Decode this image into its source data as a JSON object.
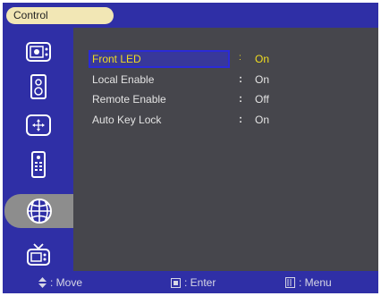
{
  "window": {
    "title": "Control"
  },
  "sidebar": {
    "items": [
      {
        "icon": "picture-icon",
        "selected": false
      },
      {
        "icon": "speaker-icon",
        "selected": false
      },
      {
        "icon": "position-icon",
        "selected": false
      },
      {
        "icon": "remote-control-icon",
        "selected": false
      },
      {
        "icon": "control-globe-icon",
        "selected": true
      },
      {
        "icon": "tv-icon",
        "selected": false
      }
    ]
  },
  "settings": [
    {
      "label": "Front LED",
      "separator": ":",
      "value": "On"
    },
    {
      "label": "Local Enable",
      "separator": ":",
      "value": "On"
    },
    {
      "label": "Remote Enable",
      "separator": ":",
      "value": "Off"
    },
    {
      "label": "Auto Key Lock",
      "separator": ":",
      "value": "On"
    }
  ],
  "footer": {
    "move": {
      "icon": "up-down-arrows-icon",
      "label": ": Move"
    },
    "enter": {
      "icon": "enter-key-icon",
      "label": ": Enter"
    },
    "menu": {
      "icon": "menu-key-icon",
      "label": ": Menu"
    }
  },
  "colors": {
    "accent": "#2f2fa6",
    "selected_text": "#f0dd20",
    "panel": "#46464c",
    "title_pill": "#f2e7b5"
  }
}
